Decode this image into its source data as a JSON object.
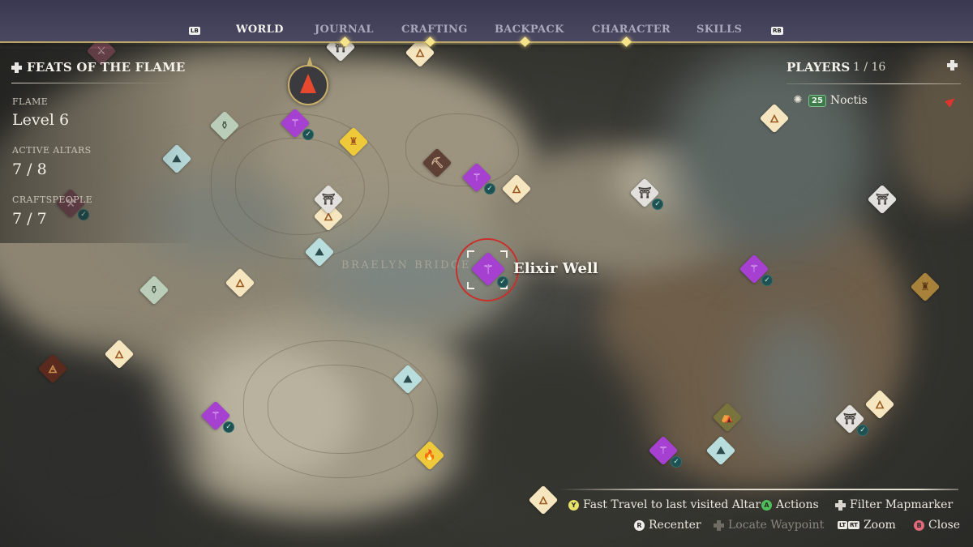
{
  "nav": {
    "left_shoulder": "LB",
    "right_shoulder": "RB",
    "tabs": [
      {
        "label": "WORLD",
        "active": true
      },
      {
        "label": "JOURNAL",
        "active": false
      },
      {
        "label": "CRAFTING",
        "active": false
      },
      {
        "label": "BACKPACK",
        "active": false
      },
      {
        "label": "CHARACTER",
        "active": false
      },
      {
        "label": "SKILLS",
        "active": false
      }
    ]
  },
  "feats": {
    "title": "FEATS OF THE FLAME",
    "flame_label": "FLAME",
    "flame_value": "Level 6",
    "altars_label": "ACTIVE ALTARS",
    "altars_value": "7 / 8",
    "craftspeople_label": "CRAFTSPEOPLE",
    "craftspeople_value": "7 / 7"
  },
  "players": {
    "title": "PLAYERS",
    "count": "1 / 16",
    "list": [
      {
        "level": "25",
        "name": "Noctis",
        "class_icon": "flame-crown-icon",
        "status_icon": "location-arrow-icon"
      }
    ]
  },
  "map": {
    "region_label": "BRAELYN BRIDGE",
    "selected_marker": "Elixir Well",
    "markers": [
      {
        "type": "elixir-well",
        "completed": true,
        "color": "purple"
      },
      {
        "type": "elixir-well",
        "completed": true,
        "color": "purple"
      },
      {
        "type": "elixir-well",
        "completed": true,
        "color": "purple"
      },
      {
        "type": "elixir-well",
        "completed": true,
        "color": "purple"
      },
      {
        "type": "elixir-well",
        "completed": true,
        "color": "purple"
      },
      {
        "type": "elixir-well",
        "completed": true,
        "color": "purple"
      },
      {
        "type": "flame-altar",
        "completed": false,
        "color": "cream"
      },
      {
        "type": "ancient-spire",
        "completed": false,
        "color": "gold"
      },
      {
        "type": "shrine-gate",
        "completed": true,
        "color": "white"
      },
      {
        "type": "mountain-camp",
        "completed": false,
        "color": "teal"
      },
      {
        "type": "mine-pickaxe",
        "completed": false,
        "color": "brown"
      },
      {
        "type": "torch",
        "completed": false,
        "color": "rust"
      },
      {
        "type": "tent-camp",
        "completed": false,
        "color": "olive"
      },
      {
        "type": "grave-shrine",
        "completed": false,
        "color": "sage"
      },
      {
        "type": "bonfire",
        "completed": false,
        "color": "gold"
      }
    ]
  },
  "hints": {
    "fast_travel": {
      "button": "Y",
      "label": "Fast Travel to last visited Altar"
    },
    "actions": {
      "button": "A",
      "label": "Actions"
    },
    "filter": {
      "button": "D-pad",
      "label": "Filter Mapmarker"
    },
    "recenter": {
      "button": "R",
      "label": "Recenter"
    },
    "locate": {
      "button": "D-pad",
      "label": "Locate Waypoint"
    },
    "zoom": {
      "button_left": "LT",
      "button_right": "RT",
      "label": "Zoom"
    },
    "close": {
      "button": "B",
      "label": "Close"
    }
  },
  "colors": {
    "accent_gold": "#b9a56a",
    "nav_bg": "#44425a",
    "selection_ring": "#c9302c",
    "elixir_purple": "#a640d0",
    "completed_check": "#1f5052",
    "player_arrow": "#e8492e"
  }
}
